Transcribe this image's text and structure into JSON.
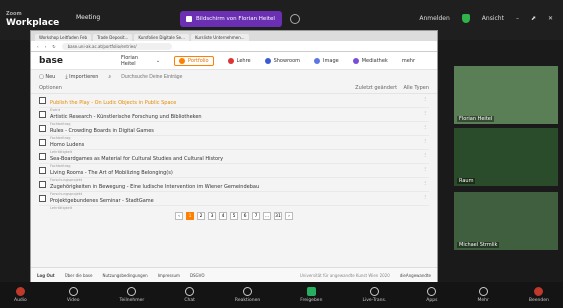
{
  "app": {
    "name": "Workplace",
    "brand_small": "Zoom"
  },
  "meeting": {
    "title": "Meeting",
    "share_label": "Bildschirm von Florian Heitel"
  },
  "top_right": {
    "status": "Anmelden",
    "participant": "Ansicht"
  },
  "browser": {
    "tabs": [
      "Workshop Leitfaden Feb",
      "Trade Deposit...",
      "Kursfolien Digitale Se...",
      "Kursliste Unternehmen..."
    ],
    "url": "base.uni-ak.ac.at/portfolio/entries/"
  },
  "toolbar": {
    "logo": "base",
    "user": "Florian Heitel",
    "items": [
      "Portfolio",
      "Lehre",
      "Showroom",
      "Image",
      "Mediathek",
      "mehr"
    ]
  },
  "actions": {
    "new": "Neu",
    "import": "Importieren",
    "search_placeholder": "Durchsuche Deine Einträge"
  },
  "list_head": {
    "options": "Optionen",
    "sort": "Zuletzt geändert",
    "filter": "Alle Typen"
  },
  "entries": [
    {
      "title": "Publish the Play - On Ludic Objects in Public Space",
      "sub": "Event"
    },
    {
      "title": "Artistic Research - Künstlerische Forschung und Bibliotheken",
      "sub": "Fachbeitrag"
    },
    {
      "title": "Rules - Crowding Boards in Digital Games",
      "sub": "Fachbeitrag"
    },
    {
      "title": "Homo Ludens",
      "sub": "Lehrtätigkeit"
    },
    {
      "title": "Sea-Boardgames as Material for Cultural Studies and Cultural History",
      "sub": "Fachbeitrag"
    },
    {
      "title": "Living Rooms - The Art of Mobilizing Belonging(s)",
      "sub": "Forschungsprojekt"
    },
    {
      "title": "Zugehörigkeiten in Bewegung - Eine ludische Intervention im Wiener Gemeindebau",
      "sub": "Forschungsprojekt"
    },
    {
      "title": "Projektgebundenes Seminar - StadtGame",
      "sub": "Lehrtätigkeit"
    }
  ],
  "pager": [
    "1",
    "2",
    "3",
    "4",
    "5",
    "6",
    "7",
    "...",
    "31"
  ],
  "footer": {
    "logout": "Log Out",
    "items": [
      "Über die base",
      "Nutzungsbedingungen",
      "Impressum",
      "DSGVO"
    ],
    "right": "Universität für angewandte Kunst Wien 2020",
    "brand": "dieAngewandte"
  },
  "tiles": [
    {
      "label": "Florian Heitel"
    },
    {
      "label": "Raum"
    },
    {
      "label": "Michael Strmlik"
    }
  ],
  "bottombar": [
    "Audio",
    "Video",
    "Teilnehmer",
    "Chat",
    "Reaktionen",
    "Freigeben",
    "Live-Trans.",
    "Apps",
    "Mehr",
    "Beenden"
  ],
  "colors": {
    "accent": "#ff7f00",
    "share": "#6b2fb3",
    "end": "#c0392b"
  }
}
